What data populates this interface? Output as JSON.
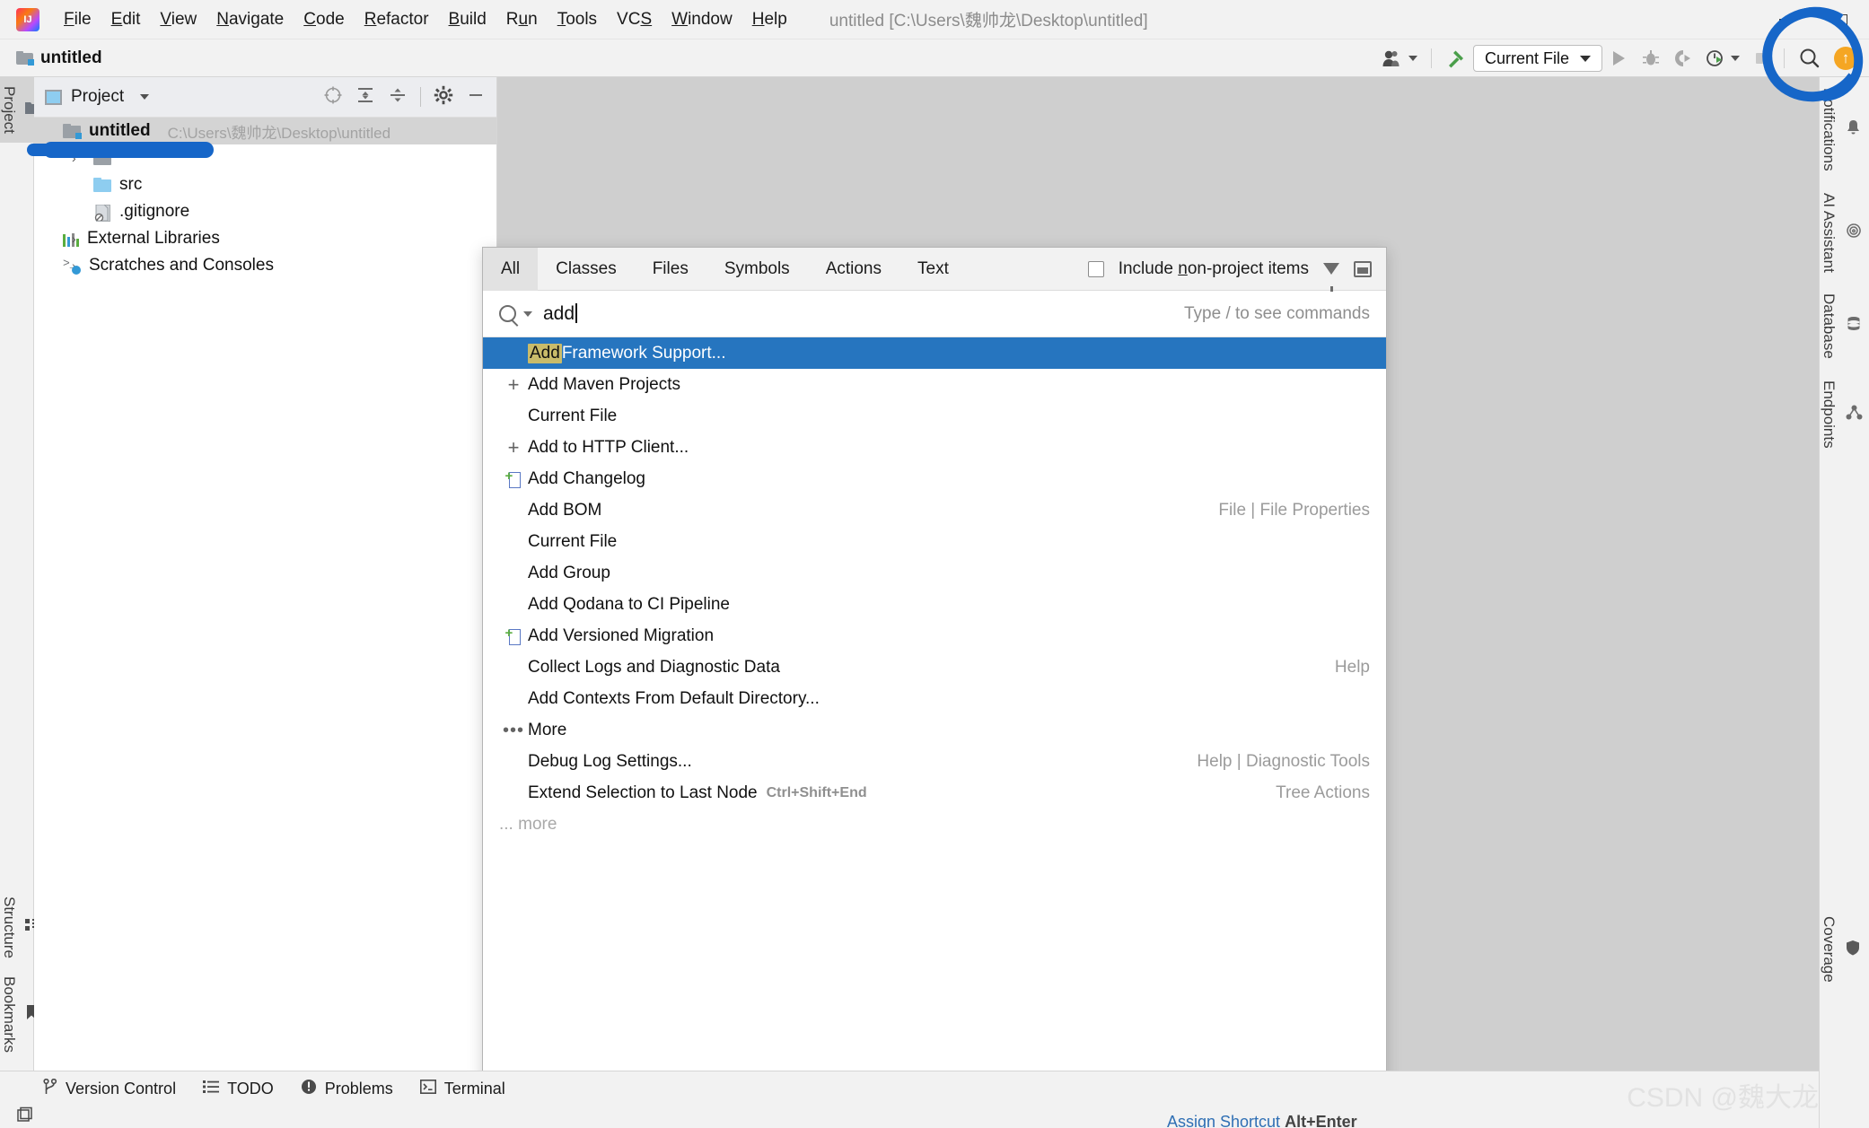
{
  "window": {
    "title": "untitled [C:\\Users\\魏帅龙\\Desktop\\untitled]",
    "minimize_label": "–",
    "maximize_label": "□"
  },
  "menu": {
    "items": [
      {
        "label": "File",
        "mnemonic": "F"
      },
      {
        "label": "Edit",
        "mnemonic": "E"
      },
      {
        "label": "View",
        "mnemonic": "V"
      },
      {
        "label": "Navigate",
        "mnemonic": "N"
      },
      {
        "label": "Code",
        "mnemonic": "C"
      },
      {
        "label": "Refactor",
        "mnemonic": "R"
      },
      {
        "label": "Build",
        "mnemonic": "B"
      },
      {
        "label": "Run",
        "mnemonic": "u"
      },
      {
        "label": "Tools",
        "mnemonic": "T"
      },
      {
        "label": "VCS",
        "mnemonic": "S"
      },
      {
        "label": "Window",
        "mnemonic": "W"
      },
      {
        "label": "Help",
        "mnemonic": "H"
      }
    ]
  },
  "navbar": {
    "breadcrumb": "untitled",
    "run_configuration": "Current File"
  },
  "left_stripe": {
    "top": [
      {
        "label": "Project",
        "icon": "project-icon",
        "active": true
      }
    ],
    "bottom": [
      {
        "label": "Structure",
        "icon": "structure-icon"
      },
      {
        "label": "Bookmarks",
        "icon": "bookmark-icon"
      }
    ]
  },
  "right_stripe": {
    "items": [
      {
        "label": "Notifications",
        "icon": "bell-icon"
      },
      {
        "label": "AI Assistant",
        "icon": "ai-icon"
      },
      {
        "label": "Database",
        "icon": "database-icon"
      },
      {
        "label": "Endpoints",
        "icon": "endpoints-icon"
      },
      {
        "label": "Coverage",
        "icon": "shield-icon"
      }
    ]
  },
  "project_panel": {
    "title": "Project",
    "tree": [
      {
        "name": "untitled",
        "path": "C:\\Users\\魏帅龙\\Desktop\\untitled",
        "icon": "module-folder-icon",
        "level": 0,
        "expanded": true,
        "selected": true,
        "bold": true
      },
      {
        "name": "",
        "path": "",
        "icon": "folder-icon",
        "level": 1,
        "redacted": true,
        "bold": false
      },
      {
        "name": "src",
        "path": "",
        "icon": "folder-blue-icon",
        "level": 1,
        "bold": false
      },
      {
        "name": ".gitignore",
        "path": "",
        "icon": "gitignore-file-icon",
        "level": 1,
        "bold": false
      },
      {
        "name": "External Libraries",
        "path": "",
        "icon": "libraries-icon",
        "level": 0,
        "expanded": false,
        "bold": false
      },
      {
        "name": "Scratches and Consoles",
        "path": "",
        "icon": "scratches-icon",
        "level": 0,
        "expanded": false,
        "bold": false
      }
    ]
  },
  "search_everywhere": {
    "tabs": [
      {
        "label": "All",
        "active": true
      },
      {
        "label": "Classes",
        "active": false
      },
      {
        "label": "Files",
        "active": false
      },
      {
        "label": "Symbols",
        "active": false
      },
      {
        "label": "Actions",
        "active": false
      },
      {
        "label": "Text",
        "active": false
      }
    ],
    "include_non_project_items": {
      "label": "Include non-project items",
      "mnemonic": "n",
      "checked": false
    },
    "query": "add",
    "placeholder": "Type / to see commands",
    "hint": "Type / to see commands",
    "more_label": "... more",
    "results": [
      {
        "prefix": "Add",
        "label": " Framework Support...",
        "icon": "none",
        "right": "",
        "shortcut": "",
        "selected": true
      },
      {
        "prefix": "",
        "label": "Add Maven Projects",
        "icon": "plus-icon",
        "right": "",
        "shortcut": "",
        "selected": false
      },
      {
        "prefix": "",
        "label": "Current File",
        "icon": "none",
        "right": "",
        "shortcut": "",
        "selected": false
      },
      {
        "prefix": "",
        "label": "Add to HTTP Client...",
        "icon": "plus-icon",
        "right": "",
        "shortcut": "",
        "selected": false
      },
      {
        "prefix": "",
        "label": "Add Changelog",
        "icon": "document-plus-icon",
        "right": "",
        "shortcut": "",
        "selected": false
      },
      {
        "prefix": "",
        "label": "Add BOM",
        "icon": "none",
        "right": "File | File Properties",
        "shortcut": "",
        "selected": false
      },
      {
        "prefix": "",
        "label": "Current File",
        "icon": "none",
        "right": "",
        "shortcut": "",
        "selected": false
      },
      {
        "prefix": "",
        "label": "Add Group",
        "icon": "none",
        "right": "",
        "shortcut": "",
        "selected": false
      },
      {
        "prefix": "",
        "label": "Add Qodana to CI Pipeline",
        "icon": "none",
        "right": "",
        "shortcut": "",
        "selected": false
      },
      {
        "prefix": "",
        "label": "Add Versioned Migration",
        "icon": "document-plus-icon",
        "right": "",
        "shortcut": "",
        "selected": false
      },
      {
        "prefix": "",
        "label": "Collect Logs and Diagnostic Data",
        "icon": "none",
        "right": "Help",
        "shortcut": "",
        "selected": false
      },
      {
        "prefix": "",
        "label": "Add Contexts From Default Directory...",
        "icon": "none",
        "right": "",
        "shortcut": "",
        "selected": false
      },
      {
        "prefix": "",
        "label": "More",
        "icon": "ellipsis-icon",
        "right": "",
        "shortcut": "",
        "selected": false
      },
      {
        "prefix": "",
        "label": "Debug Log Settings...",
        "icon": "none",
        "right": "Help | Diagnostic Tools",
        "shortcut": "",
        "selected": false
      },
      {
        "prefix": "",
        "label": "Extend Selection to Last Node",
        "icon": "none",
        "right": "Tree Actions",
        "shortcut": "Ctrl+Shift+End",
        "selected": false
      }
    ]
  },
  "bottom_tools": [
    {
      "label": "Version Control",
      "icon": "branch-icon"
    },
    {
      "label": "TODO",
      "icon": "list-icon"
    },
    {
      "label": "Problems",
      "icon": "exclamation-circle-icon"
    },
    {
      "label": "Terminal",
      "icon": "terminal-icon"
    }
  ],
  "footer": {
    "assign_shortcut": "Assign Shortcut",
    "assign_shortcut_key": "Alt+Enter",
    "watermark": "CSDN @魏大龙"
  },
  "colors": {
    "accent_blue": "#2675bf",
    "annotation_blue": "#1666c8",
    "highlight_yellow": "#c9bb6a",
    "folder_blue": "#8ecdf0"
  }
}
